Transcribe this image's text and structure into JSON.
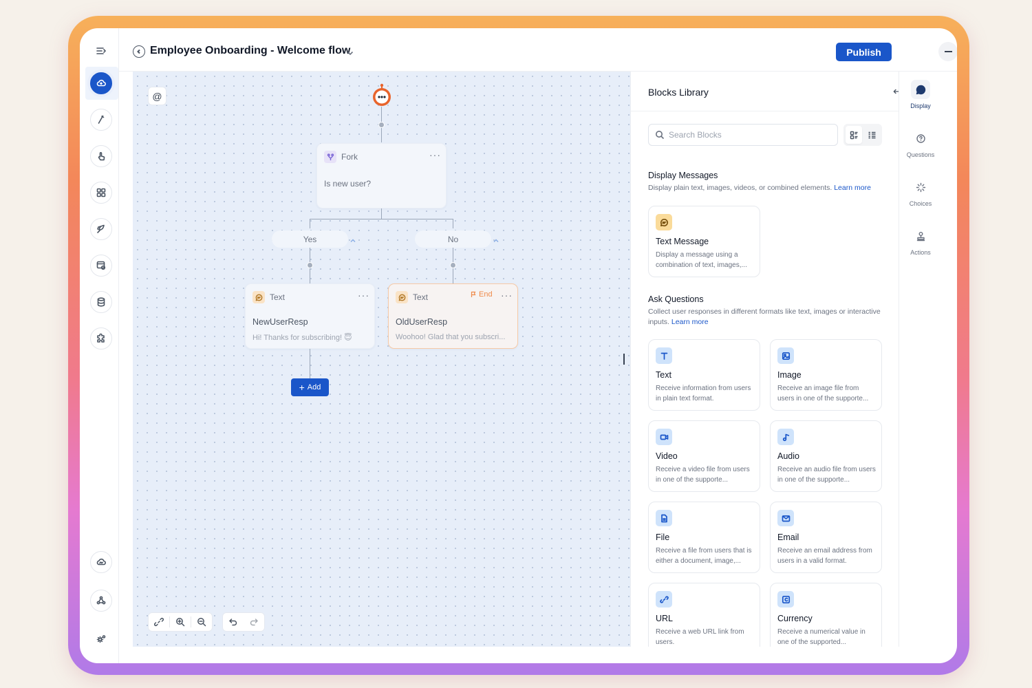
{
  "header": {
    "title": "Employee Onboarding - Welcome flow",
    "publish_label": "Publish"
  },
  "rail": {
    "items": [
      {
        "icon": "collapse-menu-icon"
      },
      {
        "icon": "cloud-icon",
        "active": true
      },
      {
        "icon": "pen-icon"
      },
      {
        "icon": "hand-pointer-icon"
      },
      {
        "icon": "grid-apps-icon"
      },
      {
        "icon": "rocket-icon"
      },
      {
        "icon": "form-settings-icon"
      },
      {
        "icon": "database-icon"
      },
      {
        "icon": "puzzle-icon"
      },
      {
        "icon": "cloud-sync-icon"
      },
      {
        "icon": "webhook-icon"
      },
      {
        "icon": "settings-gear-icon"
      }
    ]
  },
  "canvas": {
    "at_label": "@",
    "fork": {
      "type": "Fork",
      "question": "Is new user?",
      "more": "···"
    },
    "branches": {
      "yes": "Yes",
      "no": "No"
    },
    "node_new": {
      "type": "Text",
      "name": "NewUserResp",
      "preview": "Hi! Thanks for subscribing! 😇",
      "more": "···"
    },
    "node_old": {
      "type": "Text",
      "end": "End",
      "name": "OldUserResp",
      "preview": "Woohoo! Glad that you subscri...",
      "more": "···"
    },
    "add_label": "Add"
  },
  "library": {
    "title": "Blocks Library",
    "search_placeholder": "Search Blocks",
    "display": {
      "title": "Display Messages",
      "desc": "Display plain text, images, videos, or combined elements.",
      "link": "Learn more",
      "cards": [
        {
          "icon": "message-icon",
          "title": "Text Message",
          "desc": "Display a message using a combination of text, images,..."
        }
      ]
    },
    "ask": {
      "title": "Ask Questions",
      "desc": "Collect user responses in different formats like text, images or interactive inputs.",
      "link": "Learn more",
      "cards": [
        {
          "icon": "text-icon",
          "title": "Text",
          "desc": "Receive information from users in plain text format."
        },
        {
          "icon": "image-icon",
          "title": "Image",
          "desc": "Receive an image file from users in one of the supporte..."
        },
        {
          "icon": "video-icon",
          "title": "Video",
          "desc": "Receive a video file from users in one of the supporte..."
        },
        {
          "icon": "audio-icon",
          "title": "Audio",
          "desc": "Receive an audio file from users in one of the supporte..."
        },
        {
          "icon": "file-icon",
          "title": "File",
          "desc": "Receive a file from users that is either a document, image,..."
        },
        {
          "icon": "email-icon",
          "title": "Email",
          "desc": "Receive an email address from users in a valid format."
        },
        {
          "icon": "link-icon",
          "title": "URL",
          "desc": "Receive a web URL link from users."
        },
        {
          "icon": "currency-icon",
          "title": "Currency",
          "desc": "Receive a numerical value in one of the supported..."
        }
      ]
    }
  },
  "tabs": [
    {
      "label": "Display",
      "icon": "chat-bubble-icon",
      "active": true
    },
    {
      "label": "Questions",
      "icon": "question-gear-icon"
    },
    {
      "label": "Choices",
      "icon": "sparkle-pointer-icon"
    },
    {
      "label": "Actions",
      "icon": "stamp-icon"
    }
  ],
  "colors": {
    "accent": "#1a56c9",
    "canvas_bg": "#e7eef9",
    "end_badge": "#ef8a4a"
  }
}
